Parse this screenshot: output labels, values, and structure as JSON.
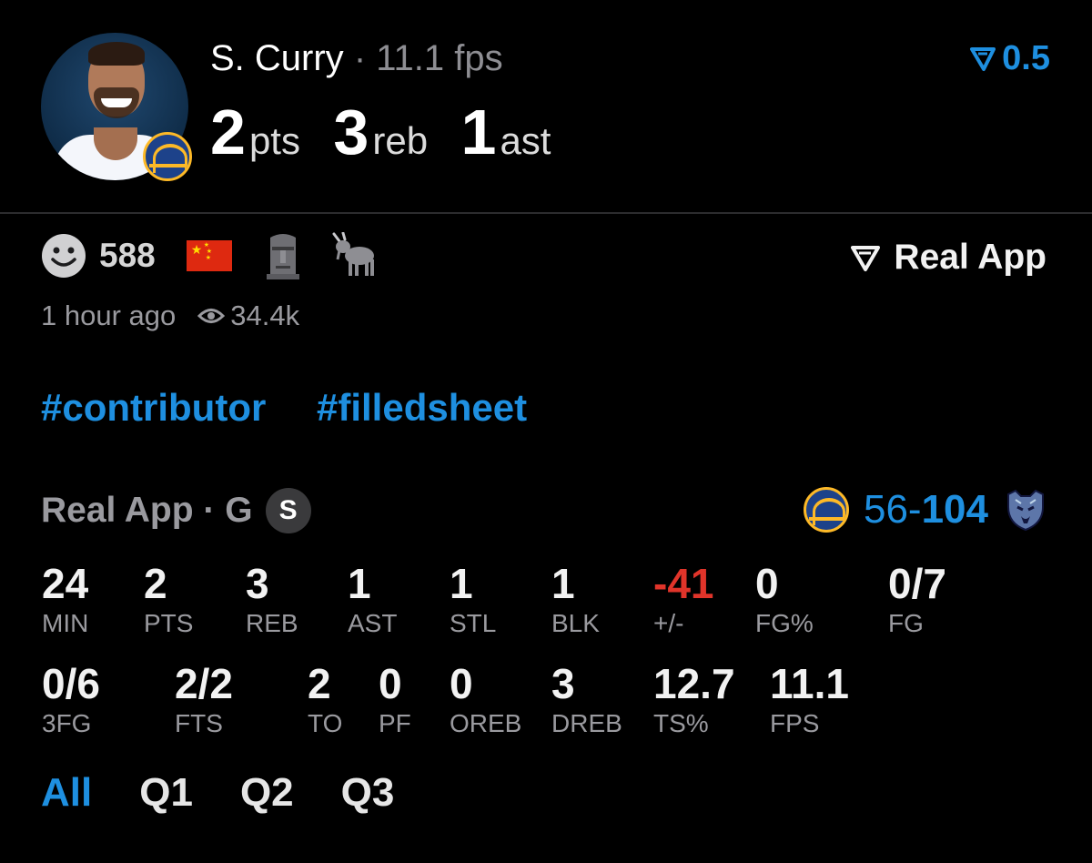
{
  "player": {
    "name": "S. Curry",
    "separator": "·",
    "fps": "11.1 fps",
    "pts": "2",
    "pts_unit": "pts",
    "reb": "3",
    "reb_unit": "reb",
    "ast": "1",
    "ast_unit": "ast"
  },
  "rating": "0.5",
  "reactions": {
    "count": "588",
    "emojis": [
      "smiley-face-icon",
      "china-flag-icon",
      "moai-icon",
      "goat-icon"
    ]
  },
  "brand": "Real App",
  "meta": {
    "time": "1 hour ago",
    "views": "34.4k"
  },
  "tags": [
    "#contributor",
    "#filledsheet"
  ],
  "game": {
    "source": "Real App · G",
    "badge": "S",
    "score_team": "56",
    "score_dash": "-",
    "score_opp": "104"
  },
  "stats_row1": [
    {
      "value": "24",
      "label": "MIN"
    },
    {
      "value": "2",
      "label": "PTS"
    },
    {
      "value": "3",
      "label": "REB"
    },
    {
      "value": "1",
      "label": "AST"
    },
    {
      "value": "1",
      "label": "STL"
    },
    {
      "value": "1",
      "label": "BLK"
    },
    {
      "value": "-41",
      "label": "+/-"
    },
    {
      "value": "0",
      "label": "FG%"
    },
    {
      "value": "0/7",
      "label": "FG"
    }
  ],
  "stats_row2": [
    {
      "value": "0/6",
      "label": "3FG"
    },
    {
      "value": "2/2",
      "label": "FTS"
    },
    {
      "value": "2",
      "label": "TO"
    },
    {
      "value": "0",
      "label": "PF"
    },
    {
      "value": "0",
      "label": "OREB"
    },
    {
      "value": "3",
      "label": "DREB"
    },
    {
      "value": "12.7",
      "label": "TS%"
    },
    {
      "value": "11.1",
      "label": "FPS"
    }
  ],
  "quarter_tabs": [
    "All",
    "Q1",
    "Q2",
    "Q3"
  ],
  "colors": {
    "accent": "#1e8fe0",
    "negative": "#e0342a",
    "muted": "#9a9a9f",
    "background": "#000000"
  }
}
